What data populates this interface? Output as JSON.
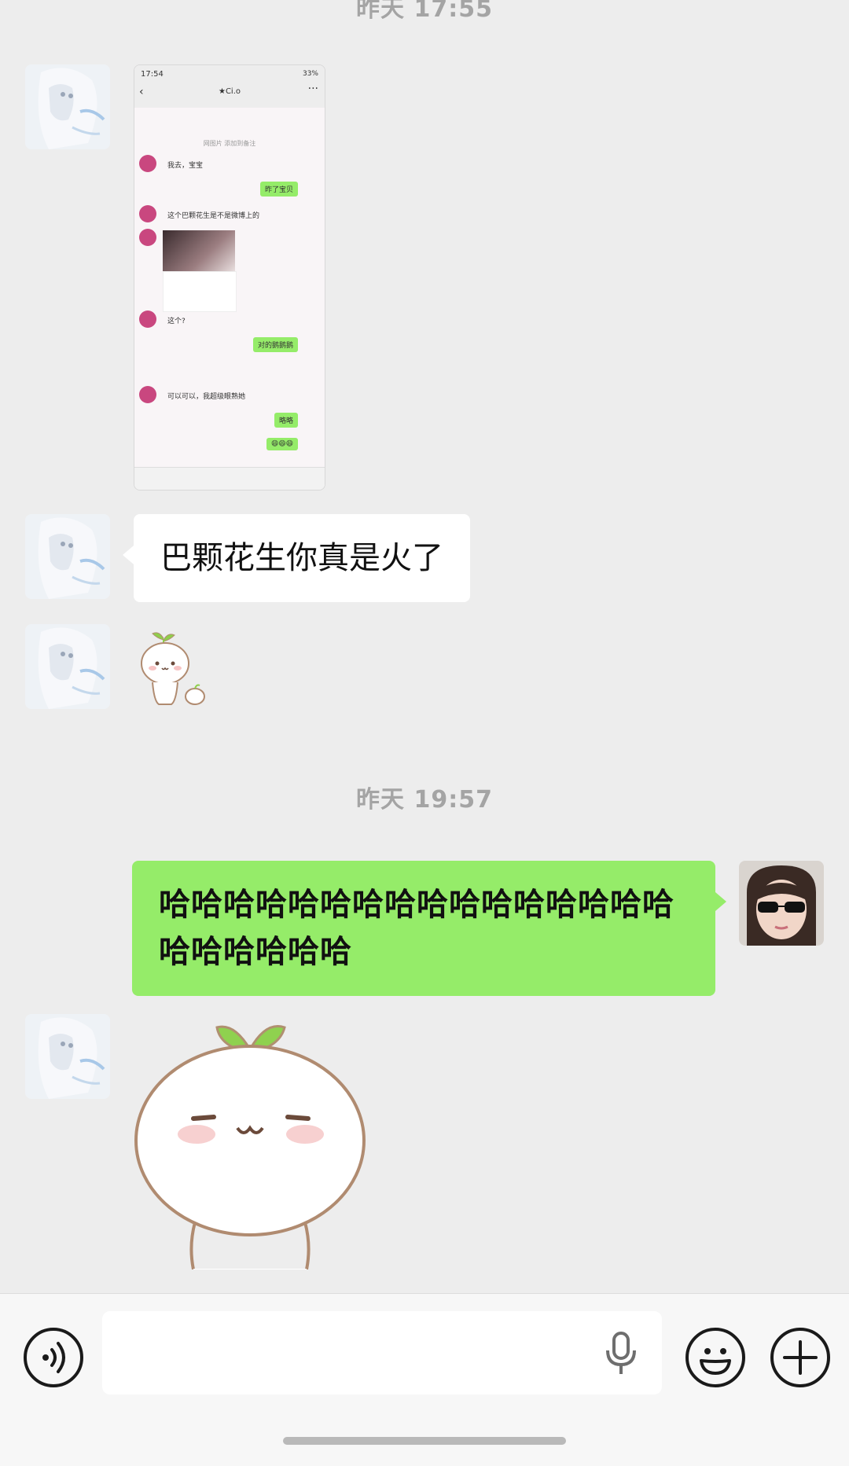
{
  "chat": {
    "timestamp_top": "昨天 17:55",
    "screenshot_thumb": {
      "time": "17:54",
      "status": "33%",
      "title": "★Ci.o",
      "sys_note": "网图片 添加到备注",
      "msgs": [
        {
          "side": "in",
          "text": "我去，宝宝"
        },
        {
          "side": "out",
          "text": "昨了宝贝"
        },
        {
          "side": "in",
          "text": "这个巴颗花生是不是微博上的"
        },
        {
          "side": "in",
          "text": "这个?"
        },
        {
          "side": "out",
          "text": "对的鹅鹅鹅"
        },
        {
          "side": "in",
          "text": "可以可以，我超级眼熟她"
        },
        {
          "side": "out",
          "text": "略略"
        },
        {
          "side": "out",
          "text": "😄😄😄"
        }
      ]
    },
    "message_1": "巴颗花生你真是火了",
    "timestamp_mid": "昨天 19:57",
    "message_out": "哈哈哈哈哈哈哈哈哈哈哈哈哈哈哈哈哈哈哈哈哈哈",
    "colors": {
      "background": "#ededed",
      "outgoing_bubble": "#95ec69",
      "incoming_bubble": "#ffffff",
      "timestamp": "#a4a4a4"
    }
  },
  "input_bar": {
    "voice_icon": "voice-icon",
    "text_value": "",
    "mic_icon": "microphone-icon",
    "emoji_icon": "emoji-icon",
    "add_icon": "plus-icon"
  }
}
